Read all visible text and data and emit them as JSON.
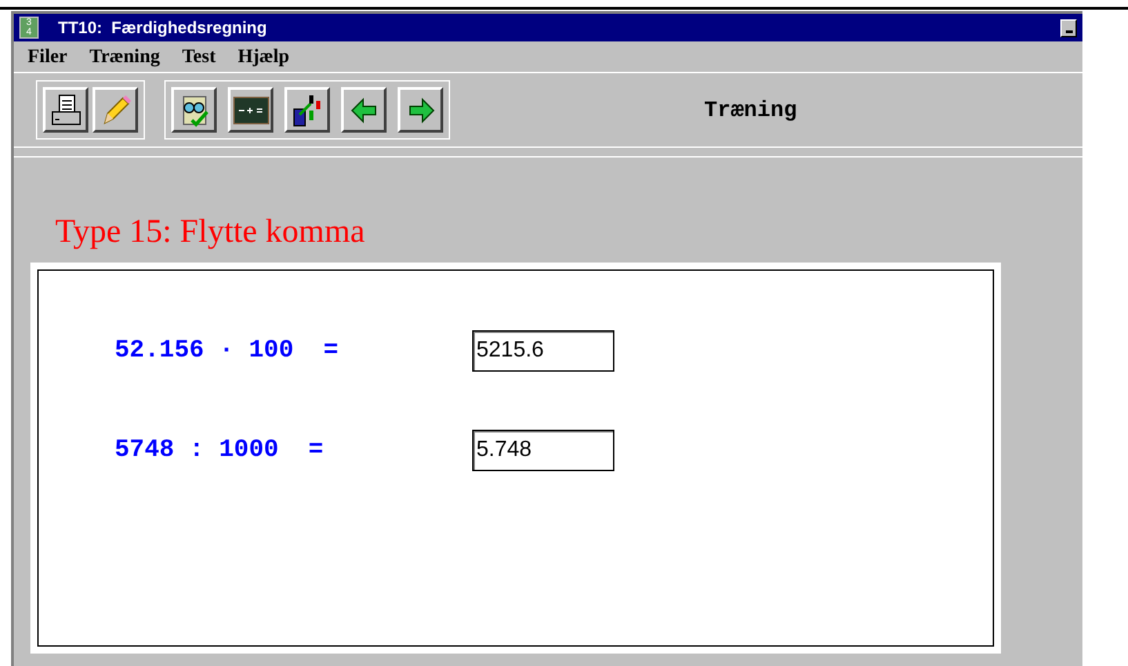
{
  "window": {
    "title": "TT10:  Færdighedsregning",
    "icon": {
      "numerator": "3",
      "denominator": "4"
    }
  },
  "menu": [
    "Filer",
    "Træning",
    "Test",
    "Hjælp"
  ],
  "mode_label": "Træning",
  "exercise_title": "Type 15: Flytte komma",
  "problems": [
    {
      "expression": "52.156 · 100  =",
      "answer": "5215.6"
    },
    {
      "expression": "5748 : 1000  =",
      "answer": "5.748"
    }
  ]
}
